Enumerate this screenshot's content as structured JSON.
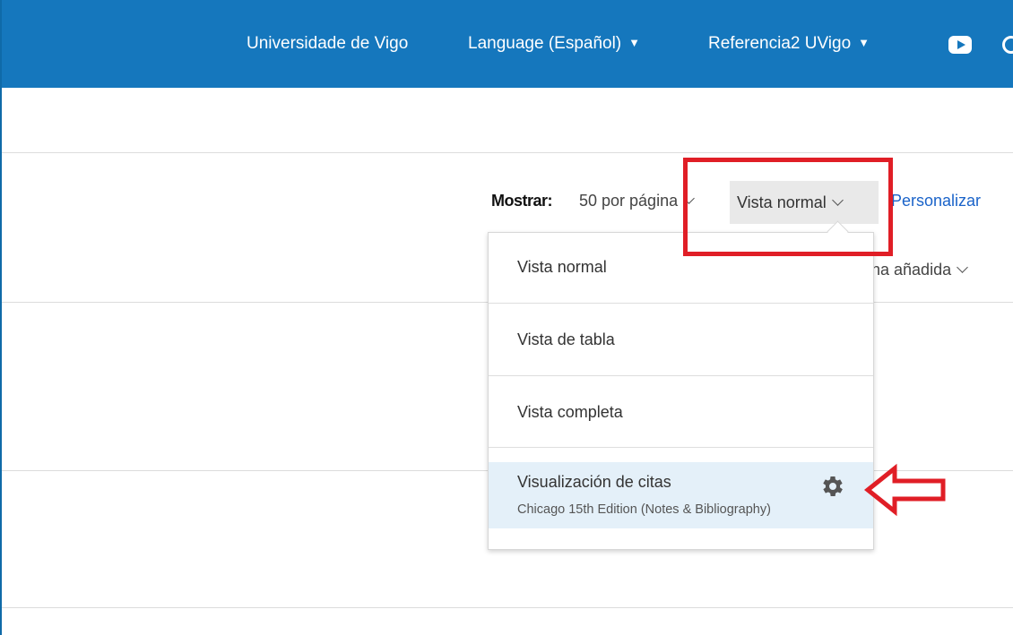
{
  "topbar": {
    "university": "Universidade de Vigo",
    "language": "Language (Español)",
    "referencia": "Referencia2 UVigo",
    "caret": "▼",
    "youtube_icon": "youtube-icon",
    "colors": {
      "bar": "#1577bd",
      "text": "#ffffff"
    }
  },
  "toolbar": {
    "mostrar_label": "Mostrar:",
    "per_page": "50 por página",
    "view_selected": "Vista normal",
    "personalizar": "Personalizar",
    "sort_partial": "ha añadida"
  },
  "view_menu": {
    "items": [
      {
        "label": "Vista normal"
      },
      {
        "label": "Vista de tabla"
      },
      {
        "label": "Vista completa"
      },
      {
        "label": "Visualización de citas",
        "sub": "Chicago 15th Edition (Notes & Bibliography)",
        "icon": "gear-icon"
      }
    ]
  },
  "annotations": {
    "highlight_color": "#e01e26"
  }
}
